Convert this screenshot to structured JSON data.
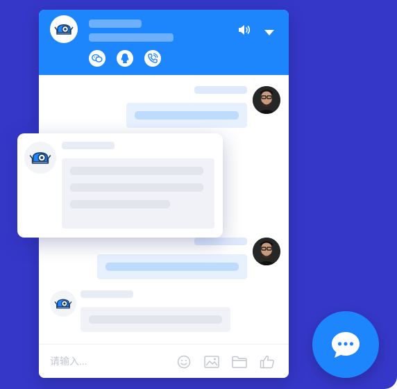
{
  "colors": {
    "background": "#3537c8",
    "header": "#1e86fc",
    "accent": "#1e86fc",
    "placeholder_bar": "#e8ecf4",
    "user_bubble": "#e7f1fe",
    "user_bar": "#bddbfd",
    "bot_bubble": "#f0f2f7"
  },
  "header": {
    "avatar_icon": "robot-icon",
    "sound_icon": "speaker-icon",
    "collapse_icon": "caret-down-icon",
    "social_icons": [
      "wechat-icon",
      "qq-icon",
      "phone-icon"
    ]
  },
  "composer": {
    "placeholder": "请输入...",
    "tools": [
      "emoji-icon",
      "image-icon",
      "folder-icon",
      "thumbs-up-icon"
    ]
  },
  "launcher": {
    "icon": "chat-bubble-icon"
  }
}
